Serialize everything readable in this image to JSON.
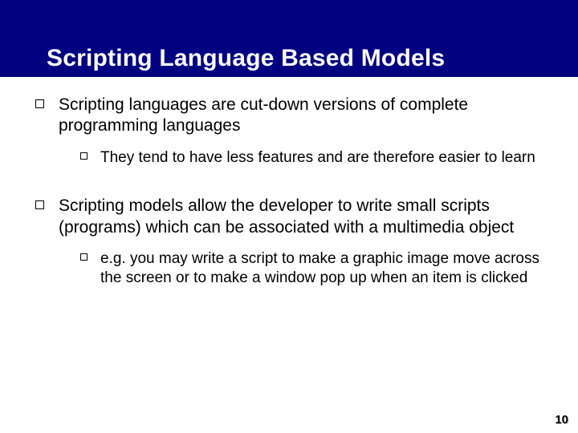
{
  "title": "Scripting Language Based Models",
  "bullets": [
    {
      "text": "Scripting languages are cut-down versions of complete programming languages",
      "sub": [
        {
          "text": "They tend to have less features and are therefore easier to learn"
        }
      ]
    },
    {
      "text": "Scripting models allow the developer to write small scripts (programs) which can be associated with a multimedia object",
      "sub": [
        {
          "text": "e.g. you may write a script to make a graphic image move across the screen or to make a window pop up when an item is clicked"
        }
      ]
    }
  ],
  "page_number": "10"
}
